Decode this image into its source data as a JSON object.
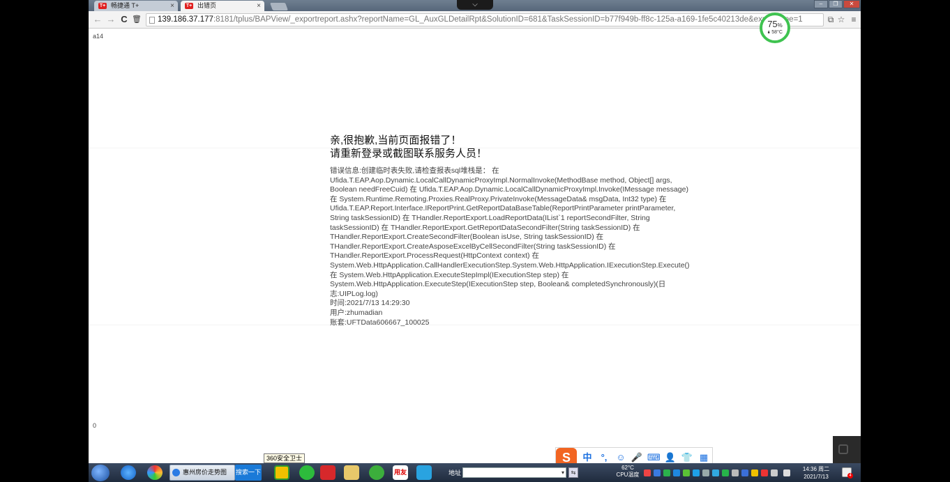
{
  "browser": {
    "tabs": [
      {
        "label": "畅捷通 T+",
        "favicon": "T+"
      },
      {
        "label": "出错页",
        "favicon": "T+"
      }
    ],
    "tab_close_glyph": "×",
    "dropdown_glyph": "⌵",
    "window_controls": {
      "minimize": "–",
      "restore": "❐",
      "close": "✕"
    },
    "nav": {
      "back": "←",
      "forward": "→",
      "reload": "C",
      "delete": "🗑"
    },
    "address": {
      "host": "139.186.37.177",
      "rest": ":8181/tplus/BAPView/_exportreport.ashx?reportName=GL_AuxGLDetailRpt&SolutionID=681&TaskSessionID=b77f949b-ff8c-125a-a169-1fe5c40213de&exportType=1"
    },
    "toolbar_right": {
      "translate": "⧉",
      "star": "☆",
      "menu": "≡"
    }
  },
  "gauge": {
    "percent": "75",
    "percent_unit": "%",
    "temp": "🌢 58°C",
    "color": "#3fc350"
  },
  "page": {
    "corner_top_left": "a14",
    "corner_bottom_left": "0",
    "error_title_1": "亲,很抱歉,当前页面报错了！",
    "error_title_2": "请重新登录或截图联系服务人员！",
    "error_lines": [
      "错误信息:创建临时表失败,请检查报表sql堆栈是： 在",
      "Ufida.T.EAP.Aop.Dynamic.LocalCallDynamicProxyImpl.NormalInvoke(MethodBase method, Object[] args,",
      "Boolean needFreeCuid) 在 Ufida.T.EAP.Aop.Dynamic.LocalCallDynamicProxyImpl.Invoke(IMessage message)",
      "在 System.Runtime.Remoting.Proxies.RealProxy.PrivateInvoke(MessageData& msgData, Int32 type) 在",
      "Ufida.T.EAP.Report.Interface.IReportPrint.GetReportDataBaseTable(ReportPrintParameter printParameter,",
      "String taskSessionID) 在 THandler.ReportExport.LoadReportData(IList`1 reportSecondFilter, String",
      "taskSessionID) 在 THandler.ReportExport.GetReportDataSecondFilter(String taskSessionID) 在",
      "THandler.ReportExport.CreateSecondFilter(Boolean isUse, String taskSessionID) 在",
      "THandler.ReportExport.CreateAsposeExcelByCellSecondFilter(String taskSessionID) 在",
      "THandler.ReportExport.ProcessRequest(HttpContext context) 在",
      "System.Web.HttpApplication.CallHandlerExecutionStep.System.Web.HttpApplication.IExecutionStep.Execute()",
      "在 System.Web.HttpApplication.ExecuteStepImpl(IExecutionStep step) 在",
      "System.Web.HttpApplication.ExecuteStep(IExecutionStep step, Boolean& completedSynchronously)(日",
      "志:UIPLog.log)",
      "时间:2021/7/13 14:29:30",
      "用户:zhumadian",
      "账套:UFTData606667_100025"
    ]
  },
  "ime_bar": {
    "logo": "S",
    "items": [
      "中",
      "°,",
      "☺",
      "🎤",
      "⌨",
      "👤",
      "👕",
      "▦"
    ]
  },
  "tooltip": "360安全卫士",
  "taskbar": {
    "ie_task_label": "惠州房价走势图",
    "search_button": "搜索一下",
    "yonyou_label": "用友",
    "address_label": "地址",
    "address_dropdown_glyph": "▾",
    "address_go_glyph": "⇆",
    "cpu_temp": "62°C",
    "cpu_label": "CPU温度",
    "clock_time": "14:36 周二",
    "clock_date": "2021/7/13",
    "notification_count": "4"
  }
}
